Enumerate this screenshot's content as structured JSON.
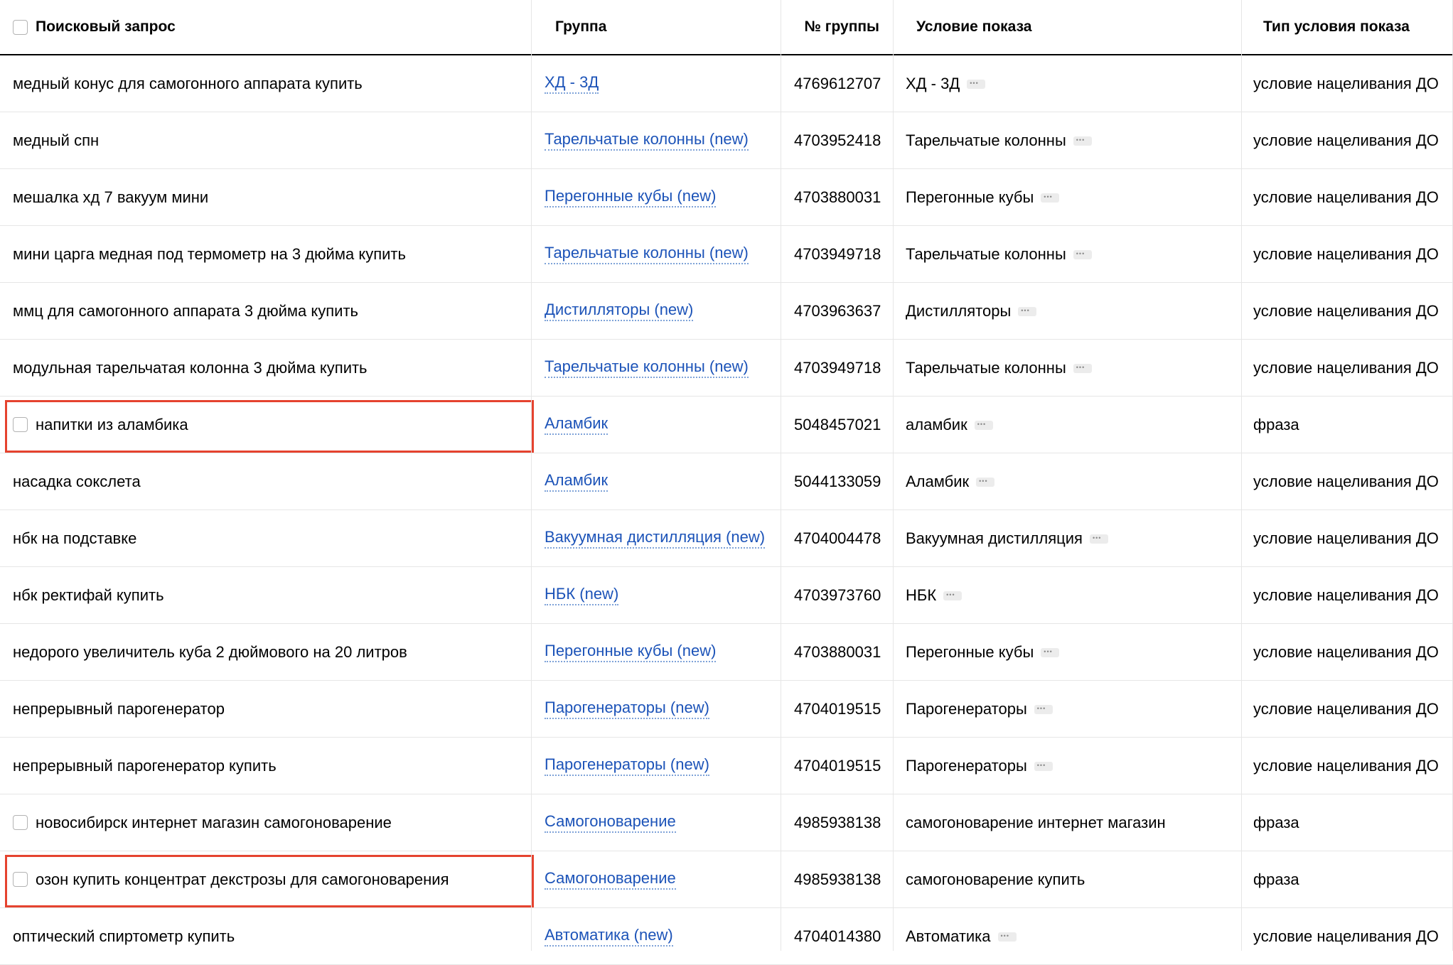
{
  "header": {
    "query": "Поисковый запрос",
    "group": "Группа",
    "group_num": "№ группы",
    "condition": "Условие показа",
    "condition_type": "Тип условия показа"
  },
  "rows": [
    {
      "query": "медный конус для самогонного аппарата купить",
      "group": "ХД - 3Д",
      "group_num": "4769612707",
      "condition": "ХД - 3Д",
      "condition_type": "условие нацеливания ДО",
      "checkbox": false,
      "more": true
    },
    {
      "query": "медный спн",
      "group": "Тарельчатые колонны (new)",
      "group_num": "4703952418",
      "condition": "Тарельчатые колонны",
      "condition_type": "условие нацеливания ДО",
      "checkbox": false,
      "more": true
    },
    {
      "query": "мешалка хд 7 вакуум мини",
      "group": "Перегонные кубы (new)",
      "group_num": "4703880031",
      "condition": "Перегонные кубы",
      "condition_type": "условие нацеливания ДО",
      "checkbox": false,
      "more": true
    },
    {
      "query": "мини царга медная под термометр на 3 дюйма купить",
      "group": "Тарельчатые колонны (new)",
      "group_num": "4703949718",
      "condition": "Тарельчатые колонны",
      "condition_type": "условие нацеливания ДО",
      "checkbox": false,
      "more": true
    },
    {
      "query": "ммц для самогонного аппарата 3 дюйма купить",
      "group": "Дистилляторы (new)",
      "group_num": "4703963637",
      "condition": "Дистилляторы",
      "condition_type": "условие нацеливания ДО",
      "checkbox": false,
      "more": true
    },
    {
      "query": "модульная тарельчатая колонна 3 дюйма купить",
      "group": "Тарельчатые колонны (new)",
      "group_num": "4703949718",
      "condition": "Тарельчатые колонны",
      "condition_type": "условие нацеливания ДО",
      "checkbox": false,
      "more": true
    },
    {
      "query": "напитки из аламбика",
      "group": "Аламбик",
      "group_num": "5048457021",
      "condition": "аламбик",
      "condition_type": "фраза",
      "checkbox": true,
      "more": true,
      "highlight": true
    },
    {
      "query": "насадка сокслета",
      "group": "Аламбик",
      "group_num": "5044133059",
      "condition": "Аламбик",
      "condition_type": "условие нацеливания ДО",
      "checkbox": false,
      "more": true
    },
    {
      "query": "нбк на подставке",
      "group": "Вакуумная дистилляция (new)",
      "group_num": "4704004478",
      "condition": "Вакуумная дистилляция",
      "condition_type": "условие нацеливания ДО",
      "checkbox": false,
      "more": true
    },
    {
      "query": "нбк ректифай купить",
      "group": "НБК (new)",
      "group_num": "4703973760",
      "condition": "НБК",
      "condition_type": "условие нацеливания ДО",
      "checkbox": false,
      "more": true
    },
    {
      "query": "недорого увеличитель куба 2 дюймового на 20 литров",
      "group": "Перегонные кубы (new)",
      "group_num": "4703880031",
      "condition": "Перегонные кубы",
      "condition_type": "условие нацеливания ДО",
      "checkbox": false,
      "more": true
    },
    {
      "query": "непрерывный парогенератор",
      "group": "Парогенераторы (new)",
      "group_num": "4704019515",
      "condition": "Парогенераторы",
      "condition_type": "условие нацеливания ДО",
      "checkbox": false,
      "more": true
    },
    {
      "query": "непрерывный парогенератор купить",
      "group": "Парогенераторы (new)",
      "group_num": "4704019515",
      "condition": "Парогенераторы",
      "condition_type": "условие нацеливания ДО",
      "checkbox": false,
      "more": true
    },
    {
      "query": "новосибирск интернет магазин самогоноварение",
      "group": "Самогоноварение",
      "group_num": "4985938138",
      "condition": "самогоноварение интернет магазин",
      "condition_type": "фраза",
      "checkbox": true,
      "more": false
    },
    {
      "query": "озон купить концентрат декстрозы для самогоноварения",
      "group": "Самогоноварение",
      "group_num": "4985938138",
      "condition": "самогоноварение купить",
      "condition_type": "фраза",
      "checkbox": true,
      "more": false,
      "highlight": true
    },
    {
      "query": "оптический спиртометр купить",
      "group": "Автоматика (new)",
      "group_num": "4704014380",
      "condition": "Автоматика",
      "condition_type": "условие нацеливания ДО",
      "checkbox": false,
      "more": true
    }
  ]
}
